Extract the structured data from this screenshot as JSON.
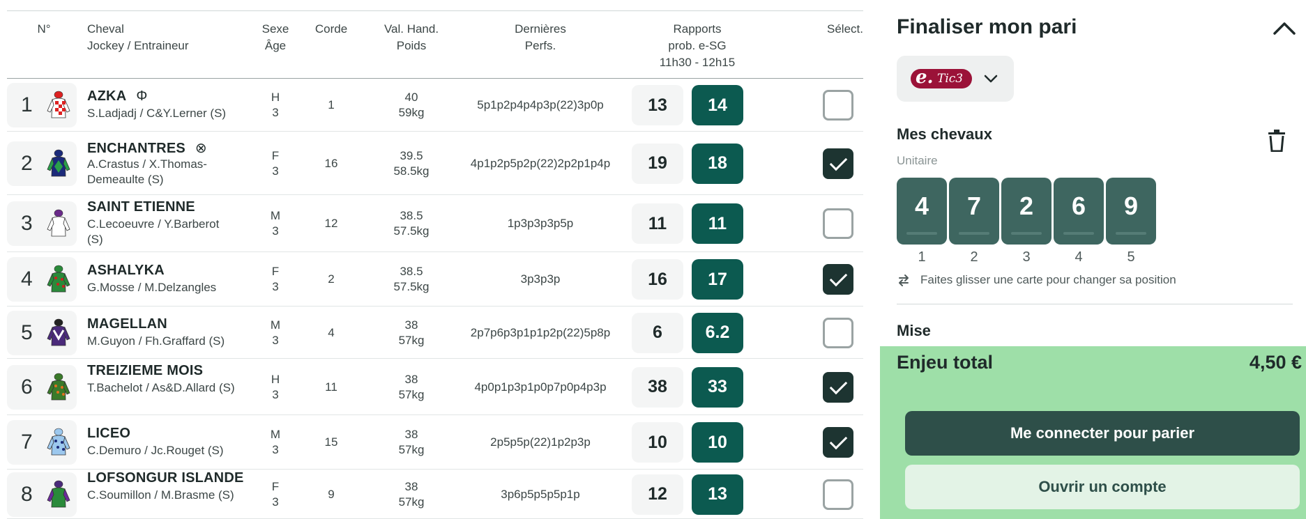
{
  "table": {
    "headers": {
      "num": "N°",
      "cheval_1": "Cheval",
      "cheval_2": "Jockey / Entraineur",
      "sexe_1": "Sexe",
      "sexe_2": "Âge",
      "corde": "Corde",
      "val_1": "Val. Hand.",
      "val_2": "Poids",
      "perfs_1": "Dernières",
      "perfs_2": "Perfs.",
      "rapports_1": "Rapports",
      "rapports_2": "prob. e-SG",
      "rapports_3": "11h30 - 12h15",
      "select": "Sélect."
    },
    "rows": [
      {
        "num": "1",
        "name": "AZKA",
        "symbol": "Φ",
        "jockey": "S.Ladjadj / C&Y.Lerner (S)",
        "sexe": "H",
        "age": "3",
        "corde": "1",
        "val": "40",
        "poids": "59kg",
        "perfs": "5p1p2p4p4p3p(22)3p0p",
        "prob": "13",
        "esg": "14",
        "selected": false,
        "silk": "red-white-check"
      },
      {
        "num": "2",
        "name": "ENCHANTRES",
        "symbol": "⊗",
        "jockey": "A.Crastus / X.Thomas-Demeaulte (S)",
        "sexe": "F",
        "age": "3",
        "corde": "16",
        "val": "39.5",
        "poids": "58.5kg",
        "perfs": "4p1p2p5p2p(22)2p2p1p4p",
        "prob": "19",
        "esg": "18",
        "selected": true,
        "silk": "navy-green-diamond"
      },
      {
        "num": "3",
        "name": "SAINT ETIENNE",
        "symbol": "",
        "jockey": "C.Lecoeuvre / Y.Barberot (S)",
        "sexe": "M",
        "age": "3",
        "corde": "12",
        "val": "38.5",
        "poids": "57.5kg",
        "perfs": "1p3p3p3p5p",
        "prob": "11",
        "esg": "11",
        "selected": false,
        "silk": "white-purple-cap"
      },
      {
        "num": "4",
        "name": "ASHALYKA",
        "symbol": "",
        "jockey": "G.Mosse / M.Delzangles",
        "sexe": "F",
        "age": "3",
        "corde": "2",
        "val": "38.5",
        "poids": "57.5kg",
        "perfs": "3p3p3p",
        "prob": "16",
        "esg": "17",
        "selected": true,
        "silk": "green-red-spots"
      },
      {
        "num": "5",
        "name": "MAGELLAN",
        "symbol": "",
        "jockey": "M.Guyon / Fh.Graffard (S)",
        "sexe": "M",
        "age": "3",
        "corde": "4",
        "val": "38",
        "poids": "57kg",
        "perfs": "2p7p6p3p1p1p2p(22)5p8p",
        "prob": "6",
        "esg": "6.2",
        "selected": false,
        "silk": "purple-white-chevron"
      },
      {
        "num": "6",
        "name": "TREIZIEME MOIS",
        "symbol": "",
        "jockey": "T.Bachelot / As&D.Allard (S)",
        "sexe": "H",
        "age": "3",
        "corde": "11",
        "val": "38",
        "poids": "57kg",
        "perfs": "4p0p1p3p1p0p7p0p4p3p",
        "prob": "38",
        "esg": "33",
        "selected": true,
        "silk": "green-orange-spots"
      },
      {
        "num": "7",
        "name": "LICEO",
        "symbol": "",
        "jockey": "C.Demuro / Jc.Rouget (S)",
        "sexe": "M",
        "age": "3",
        "corde": "15",
        "val": "38",
        "poids": "57kg",
        "perfs": "2p5p5p(22)1p2p3p",
        "prob": "10",
        "esg": "10",
        "selected": true,
        "silk": "lightblue-navy-dots"
      },
      {
        "num": "8",
        "name": "LOFSONGUR ISLANDE",
        "symbol": "",
        "jockey": "C.Soumillon / M.Brasme (S)",
        "sexe": "F",
        "age": "3",
        "corde": "9",
        "val": "38",
        "poids": "57kg",
        "perfs": "3p6p5p5p5p1p",
        "prob": "12",
        "esg": "13",
        "selected": false,
        "silk": "green-purple-sleeves"
      }
    ]
  },
  "panel": {
    "title": "Finaliser mon pari",
    "bet_type": {
      "prefix": "e.",
      "label": "Tic3"
    },
    "horses_title": "Mes chevaux",
    "mode": "Unitaire",
    "cards": [
      {
        "value": "4",
        "position": "1"
      },
      {
        "value": "7",
        "position": "2"
      },
      {
        "value": "2",
        "position": "3"
      },
      {
        "value": "6",
        "position": "4"
      },
      {
        "value": "9",
        "position": "5"
      }
    ],
    "hint": "Faites glisser une carte pour changer sa position",
    "mise_label": "Mise",
    "enjeu_label": "Enjeu total",
    "enjeu_value": "4,50 €",
    "login_button": "Me connecter pour parier",
    "open_account_button": "Ouvrir un compte"
  },
  "colors": {
    "esg_odds": "#0c5a50",
    "checkbox_on": "#1d3431",
    "card": "#3e6660",
    "summary_bg": "#9edfa8",
    "primary_button": "#2e4f49",
    "tic3_badge": "#9b1238"
  }
}
